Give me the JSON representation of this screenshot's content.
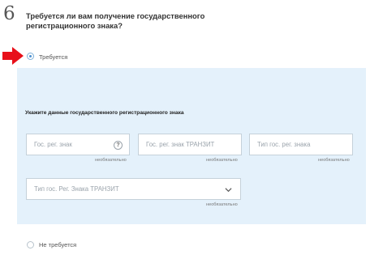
{
  "step": {
    "number": "6",
    "question": "Требуется ли вам получение государственного регистрационного знака?"
  },
  "options": {
    "required_label": "Требуется",
    "not_required_label": "Не требуется",
    "selected": "required"
  },
  "panel": {
    "title": "Укажите данные государственного регистрационного знака",
    "fields": [
      {
        "placeholder": "Гос. рег. знак",
        "hint": "необязательно",
        "icon": "question-icon"
      },
      {
        "placeholder": "Гос. рег. знак ТРАНЗИТ",
        "hint": "необязательно"
      },
      {
        "placeholder": "Тип гос. рег. знака",
        "hint": "необязательно"
      },
      {
        "placeholder": "Тип гос. Рег. Знака ТРАНЗИТ",
        "hint": "необязательно",
        "icon": "chevron-down-icon"
      }
    ],
    "help_glyph": "?"
  },
  "colors": {
    "arrow": "#e8101a",
    "panel_bg": "#e4f1fb",
    "radio_accent": "#4b8fd0"
  }
}
